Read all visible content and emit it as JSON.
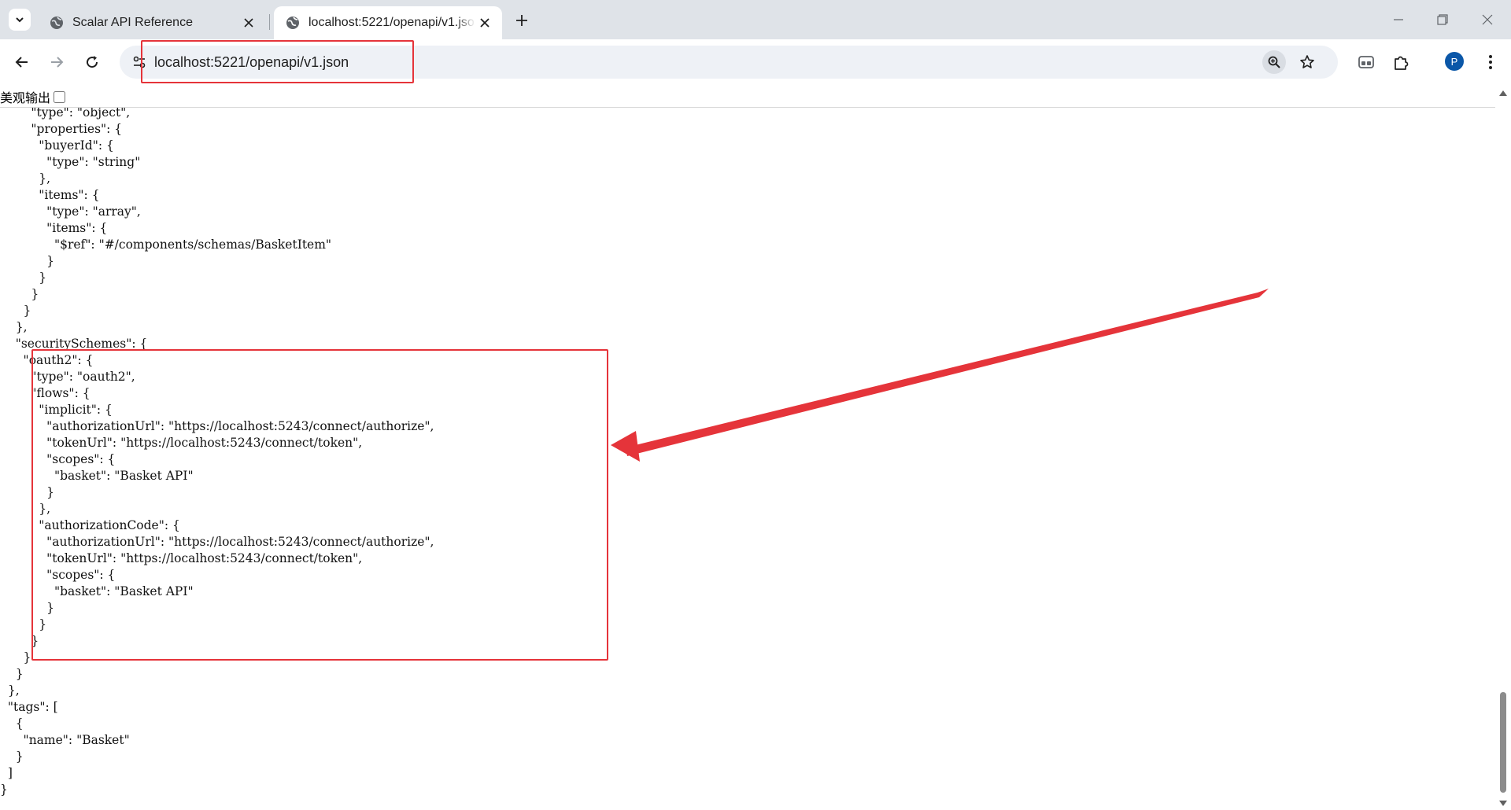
{
  "browser": {
    "tabs": [
      {
        "title": "Scalar API Reference",
        "active": false
      },
      {
        "title": "localhost:5221/openapi/v1.json",
        "active": true
      }
    ],
    "address_bar": {
      "url": "localhost:5221/openapi/v1.json"
    },
    "profile_initial": "P"
  },
  "json_viewer": {
    "pretty_print_label": "美观输出",
    "pretty_print_checked": false,
    "content_lines": [
      "        \"type\": \"object\",",
      "        \"properties\": {",
      "          \"buyerId\": {",
      "            \"type\": \"string\"",
      "          },",
      "          \"items\": {",
      "            \"type\": \"array\",",
      "            \"items\": {",
      "              \"$ref\": \"#/components/schemas/BasketItem\"",
      "            }",
      "          }",
      "        }",
      "      }",
      "    },",
      "    \"securitySchemes\": {",
      "      \"oauth2\": {",
      "        \"type\": \"oauth2\",",
      "        \"flows\": {",
      "          \"implicit\": {",
      "            \"authorizationUrl\": \"https://localhost:5243/connect/authorize\",",
      "            \"tokenUrl\": \"https://localhost:5243/connect/token\",",
      "            \"scopes\": {",
      "              \"basket\": \"Basket API\"",
      "            }",
      "          },",
      "          \"authorizationCode\": {",
      "            \"authorizationUrl\": \"https://localhost:5243/connect/authorize\",",
      "            \"tokenUrl\": \"https://localhost:5243/connect/token\",",
      "            \"scopes\": {",
      "              \"basket\": \"Basket API\"",
      "            }",
      "          }",
      "        }",
      "      }",
      "    }",
      "  },",
      "  \"tags\": [",
      "    {",
      "      \"name\": \"Basket\"",
      "    }",
      "  ]",
      "}"
    ]
  },
  "colors": {
    "annotation_red": "#e5343a",
    "tabstrip_bg": "#dfe3e8",
    "omnibox_bg": "#eef1f6",
    "avatar_bg": "#0b57a8"
  },
  "icons": [
    "tab-search-icon",
    "globe-icon",
    "close-icon",
    "plus-icon",
    "minimize-icon",
    "restore-icon",
    "back-arrow-icon",
    "forward-arrow-icon",
    "reload-icon",
    "site-info-icon",
    "zoom-icon",
    "star-icon",
    "media-icon",
    "extensions-icon",
    "more-vert-icon"
  ]
}
